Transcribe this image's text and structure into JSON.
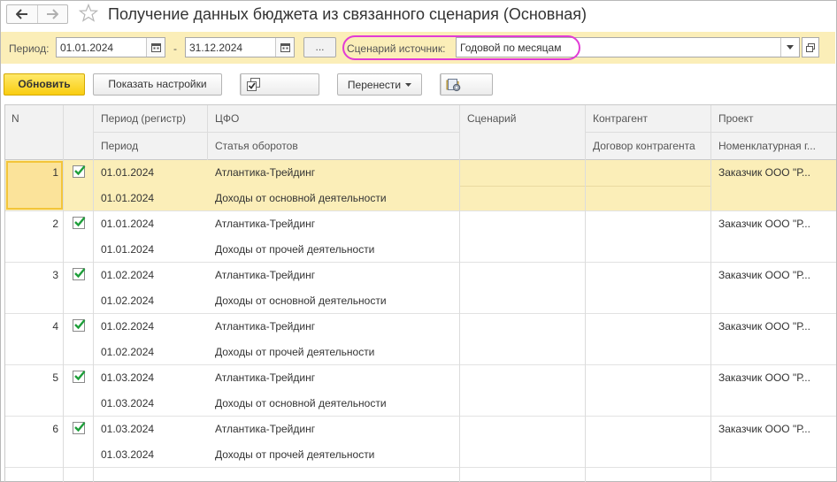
{
  "window": {
    "title": "Получение данных бюджета из связанного сценария (Основная)",
    "icons": {
      "back": "arrow-left-icon",
      "forward": "arrow-right-icon",
      "favorite": "star-icon"
    }
  },
  "filters": {
    "period_label": "Период:",
    "period_from": "01.01.2024",
    "period_separator": "-",
    "period_to": "31.12.2024",
    "select_period_button": "...",
    "scenario_label": "Сценарий источник:",
    "scenario_value": "Годовой по месяцам",
    "highlight_color": "#e23bd6"
  },
  "toolbar": {
    "refresh_label": "Обновить",
    "show_settings_label": "Показать настройки",
    "move_label": "Перенести",
    "accent_color": "#f9cd10"
  },
  "table": {
    "headers": {
      "n": "N",
      "period_register": "Период (регистр)",
      "period": "Период",
      "cfo": "ЦФО",
      "turnover_item": "Статья оборотов",
      "scenario": "Сценарий",
      "counterparty": "Контрагент",
      "contract": "Договор контрагента",
      "project": "Проект",
      "nomenclature_group": "Номенклатурная г..."
    },
    "rows": [
      {
        "n": "1",
        "checked": true,
        "period_register": "01.01.2024",
        "period": "01.01.2024",
        "cfo": "Атлантика-Трейдинг",
        "item": "Доходы от основной деятельности",
        "scenario": "",
        "counterparty": "",
        "contract": "",
        "project": "Заказчик ООО \"Р...",
        "selected": true
      },
      {
        "n": "2",
        "checked": true,
        "period_register": "01.01.2024",
        "period": "01.01.2024",
        "cfo": "Атлантика-Трейдинг",
        "item": "Доходы от прочей деятельности",
        "scenario": "",
        "counterparty": "",
        "contract": "",
        "project": "Заказчик ООО \"Р...",
        "selected": false
      },
      {
        "n": "3",
        "checked": true,
        "period_register": "01.02.2024",
        "period": "01.02.2024",
        "cfo": "Атлантика-Трейдинг",
        "item": "Доходы от основной деятельности",
        "scenario": "",
        "counterparty": "",
        "contract": "",
        "project": "Заказчик ООО \"Р...",
        "selected": false
      },
      {
        "n": "4",
        "checked": true,
        "period_register": "01.02.2024",
        "period": "01.02.2024",
        "cfo": "Атлантика-Трейдинг",
        "item": "Доходы от прочей деятельности",
        "scenario": "",
        "counterparty": "",
        "contract": "",
        "project": "Заказчик ООО \"Р...",
        "selected": false
      },
      {
        "n": "5",
        "checked": true,
        "period_register": "01.03.2024",
        "period": "01.03.2024",
        "cfo": "Атлантика-Трейдинг",
        "item": "Доходы от основной деятельности",
        "scenario": "",
        "counterparty": "",
        "contract": "",
        "project": "Заказчик ООО \"Р...",
        "selected": false
      },
      {
        "n": "6",
        "checked": true,
        "period_register": "01.03.2024",
        "period": "01.03.2024",
        "cfo": "Атлантика-Трейдинг",
        "item": "Доходы от прочей деятельности",
        "scenario": "",
        "counterparty": "",
        "contract": "",
        "project": "Заказчик ООО \"Р...",
        "selected": false
      }
    ]
  }
}
